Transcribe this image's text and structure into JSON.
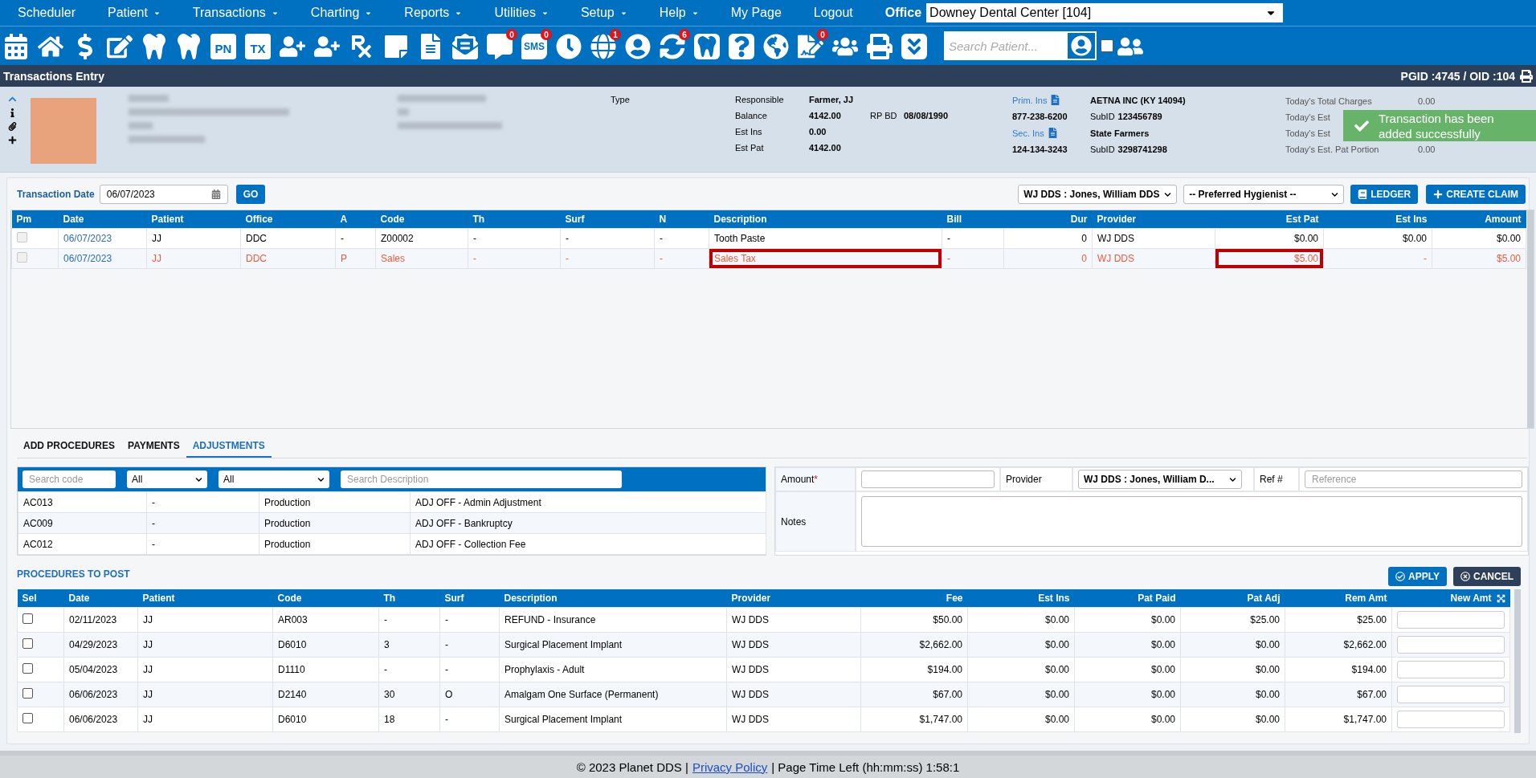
{
  "menu": {
    "items": [
      {
        "label": "Scheduler",
        "dropdown": false
      },
      {
        "label": "Patient",
        "dropdown": true
      },
      {
        "label": "Transactions",
        "dropdown": true
      },
      {
        "label": "Charting",
        "dropdown": true
      },
      {
        "label": "Reports",
        "dropdown": true
      },
      {
        "label": "Utilities",
        "dropdown": true
      },
      {
        "label": "Setup",
        "dropdown": true
      },
      {
        "label": "Help",
        "dropdown": true
      },
      {
        "label": "My Page",
        "dropdown": false
      },
      {
        "label": "Logout",
        "dropdown": false
      }
    ],
    "office_label": "Office",
    "office_value": "Downey Dental Center [104]"
  },
  "toolbar": {
    "items": [
      {
        "kind": "icon"
      },
      {
        "kind": "icon"
      },
      {
        "kind": "icon"
      },
      {
        "kind": "icon"
      },
      {
        "kind": "icon"
      },
      {
        "kind": "icon"
      },
      {
        "kind": "label",
        "label": "PN"
      },
      {
        "kind": "label",
        "label": "TX"
      },
      {
        "kind": "icon"
      },
      {
        "kind": "icon"
      },
      {
        "kind": "icon"
      },
      {
        "kind": "icon"
      },
      {
        "kind": "icon"
      },
      {
        "kind": "icon"
      },
      {
        "kind": "icon",
        "badge": "0"
      },
      {
        "kind": "bubble",
        "label": "SMS",
        "badge": "0"
      },
      {
        "kind": "icon"
      },
      {
        "kind": "icon",
        "badge": "1"
      },
      {
        "kind": "icon"
      },
      {
        "kind": "icon",
        "badge": "6"
      },
      {
        "kind": "icon"
      },
      {
        "kind": "icon"
      },
      {
        "kind": "icon"
      },
      {
        "kind": "icon",
        "badge": "0"
      },
      {
        "kind": "icon"
      },
      {
        "kind": "icon"
      },
      {
        "kind": "icon"
      }
    ],
    "search_placeholder": "Search Patient...",
    "checkbox_checked": false
  },
  "title_bar": {
    "title": "Transactions Entry",
    "ids": "PGID :4745 / OID :104"
  },
  "patient": {
    "type_label": "Type",
    "account": [
      {
        "label": "Responsible",
        "value": "Farmer, JJ"
      },
      {
        "label": "Balance",
        "value": "4142.00",
        "extra_label": "RP BD",
        "extra_value": "08/08/1990"
      },
      {
        "label": "Est Ins",
        "value": "0.00"
      },
      {
        "label": "Est Pat",
        "value": "4142.00"
      }
    ],
    "insurance": [
      {
        "link": "Prim. Ins",
        "carrier": "AETNA INC (KY 14094)",
        "phone": "877-238-6200",
        "subid_label": "SubID",
        "subid": "123456789"
      },
      {
        "link": "Sec. Ins",
        "carrier": "State Farmers",
        "phone": "124-134-3243",
        "subid_label": "SubID",
        "subid": "3298741298"
      }
    ],
    "totals": [
      {
        "label": "Today's Total Charges",
        "value": "0.00"
      },
      {
        "label": "Today's Est"
      },
      {
        "label": "Today's Est"
      },
      {
        "label": "Today's Est. Pat Portion",
        "value": "0.00"
      }
    ]
  },
  "toast": {
    "message": "Transaction has been added successfully"
  },
  "transactions": {
    "date_label": "Transaction Date",
    "date": "06/07/2023",
    "go": "GO",
    "provider": "WJ DDS : Jones, William DDS",
    "hygienist": "-- Preferred Hygienist --",
    "ledger": "LEDGER",
    "create_claim": "CREATE CLAIM",
    "check_column": "Pm",
    "columns": [
      "Date",
      "Patient",
      "Office",
      "A",
      "Code",
      "Th",
      "Surf",
      "N",
      "Description",
      "Bill",
      "Dur",
      "Provider",
      "Est Pat",
      "Est Ins",
      "Amount"
    ],
    "rows": [
      {
        "checked": false,
        "flagged": false,
        "cells": [
          {
            "text": "06/07/2023",
            "boxed": false
          },
          {
            "text": "JJ",
            "boxed": false
          },
          {
            "text": "DDC",
            "boxed": false
          },
          {
            "text": "-",
            "boxed": false
          },
          {
            "text": "Z00002",
            "boxed": false
          },
          {
            "text": "-",
            "boxed": false
          },
          {
            "text": "-",
            "boxed": false
          },
          {
            "text": "-",
            "boxed": false
          },
          {
            "text": "Tooth Paste",
            "boxed": false
          },
          {
            "text": "-",
            "boxed": false
          },
          {
            "text": "0",
            "boxed": false
          },
          {
            "text": "WJ DDS",
            "boxed": false
          },
          {
            "text": "$0.00",
            "boxed": false
          },
          {
            "text": "$0.00",
            "boxed": false
          },
          {
            "text": "$0.00",
            "boxed": false
          }
        ]
      },
      {
        "checked": false,
        "flagged": true,
        "cells": [
          {
            "text": "06/07/2023",
            "boxed": false
          },
          {
            "text": "JJ",
            "boxed": false
          },
          {
            "text": "DDC",
            "boxed": false
          },
          {
            "text": "P",
            "boxed": false
          },
          {
            "text": "Sales",
            "boxed": false
          },
          {
            "text": "-",
            "boxed": false
          },
          {
            "text": "-",
            "boxed": false
          },
          {
            "text": "-",
            "boxed": false
          },
          {
            "text": "Sales Tax",
            "boxed": true
          },
          {
            "text": "-",
            "boxed": false
          },
          {
            "text": "0",
            "boxed": false
          },
          {
            "text": "WJ DDS",
            "boxed": false
          },
          {
            "text": "$5.00",
            "boxed": true
          },
          {
            "text": "-",
            "boxed": false
          },
          {
            "text": "$5.00",
            "boxed": false
          }
        ]
      }
    ]
  },
  "tabs": [
    {
      "label": "ADD PROCEDURES",
      "selected": false
    },
    {
      "label": "PAYMENTS",
      "selected": false
    },
    {
      "label": "ADJUSTMENTS",
      "selected": true
    }
  ],
  "adjustments": {
    "code_placeholder": "Search code",
    "filters": [
      "All",
      "All"
    ],
    "description_placeholder": "Search Description",
    "rows": [
      [
        "AC013",
        "-",
        "Production",
        "ADJ OFF - Admin Adjustment"
      ],
      [
        "AC009",
        "-",
        "Production",
        "ADJ OFF - Bankruptcy"
      ],
      [
        "AC012",
        "-",
        "Production",
        "ADJ OFF - Collection Fee"
      ]
    ]
  },
  "form": {
    "amount_label": "Amount",
    "required_mark": "*",
    "provider_label": "Provider",
    "provider": "WJ DDS : Jones, William D...",
    "ref_label": "Ref #",
    "ref_placeholder": "Reference",
    "notes_label": "Notes"
  },
  "procedures": {
    "title": "PROCEDURES TO POST",
    "apply": "APPLY",
    "cancel": "CANCEL",
    "select_column": "Sel",
    "columns": [
      "Date",
      "Patient",
      "Code",
      "Th",
      "Surf",
      "Description",
      "Provider",
      "Fee",
      "Est Ins",
      "Pat Paid",
      "Pat Adj",
      "Rem Amt",
      "New Amt"
    ],
    "rows": [
      {
        "selected": false,
        "cells": [
          "02/11/2023",
          "JJ",
          "AR003",
          "-",
          "-",
          "REFUND - Insurance",
          "WJ DDS",
          "$50.00",
          "$0.00",
          "$0.00",
          "$25.00",
          "$25.00"
        ]
      },
      {
        "selected": false,
        "cells": [
          "04/29/2023",
          "JJ",
          "D6010",
          "3",
          "-",
          "Surgical Placement Implant",
          "WJ DDS",
          "$2,662.00",
          "$0.00",
          "$0.00",
          "$0.00",
          "$2,662.00"
        ]
      },
      {
        "selected": false,
        "cells": [
          "05/04/2023",
          "JJ",
          "D1110",
          "-",
          "-",
          "Prophylaxis - Adult",
          "WJ DDS",
          "$194.00",
          "$0.00",
          "$0.00",
          "$0.00",
          "$194.00"
        ]
      },
      {
        "selected": false,
        "cells": [
          "06/06/2023",
          "JJ",
          "D2140",
          "30",
          "O",
          "Amalgam One Surface (Permanent)",
          "WJ DDS",
          "$67.00",
          "$0.00",
          "$0.00",
          "$0.00",
          "$67.00"
        ]
      },
      {
        "selected": false,
        "cells": [
          "06/06/2023",
          "JJ",
          "D6010",
          "18",
          "-",
          "Surgical Placement Implant",
          "WJ DDS",
          "$1,747.00",
          "$0.00",
          "$0.00",
          "$0.00",
          "$1,747.00"
        ]
      }
    ]
  },
  "footer": {
    "copyright": "© 2023 Planet DDS |",
    "link": "Privacy Policy",
    "session": "| Page Time Left (hh:mm:ss) 1:58:1"
  }
}
